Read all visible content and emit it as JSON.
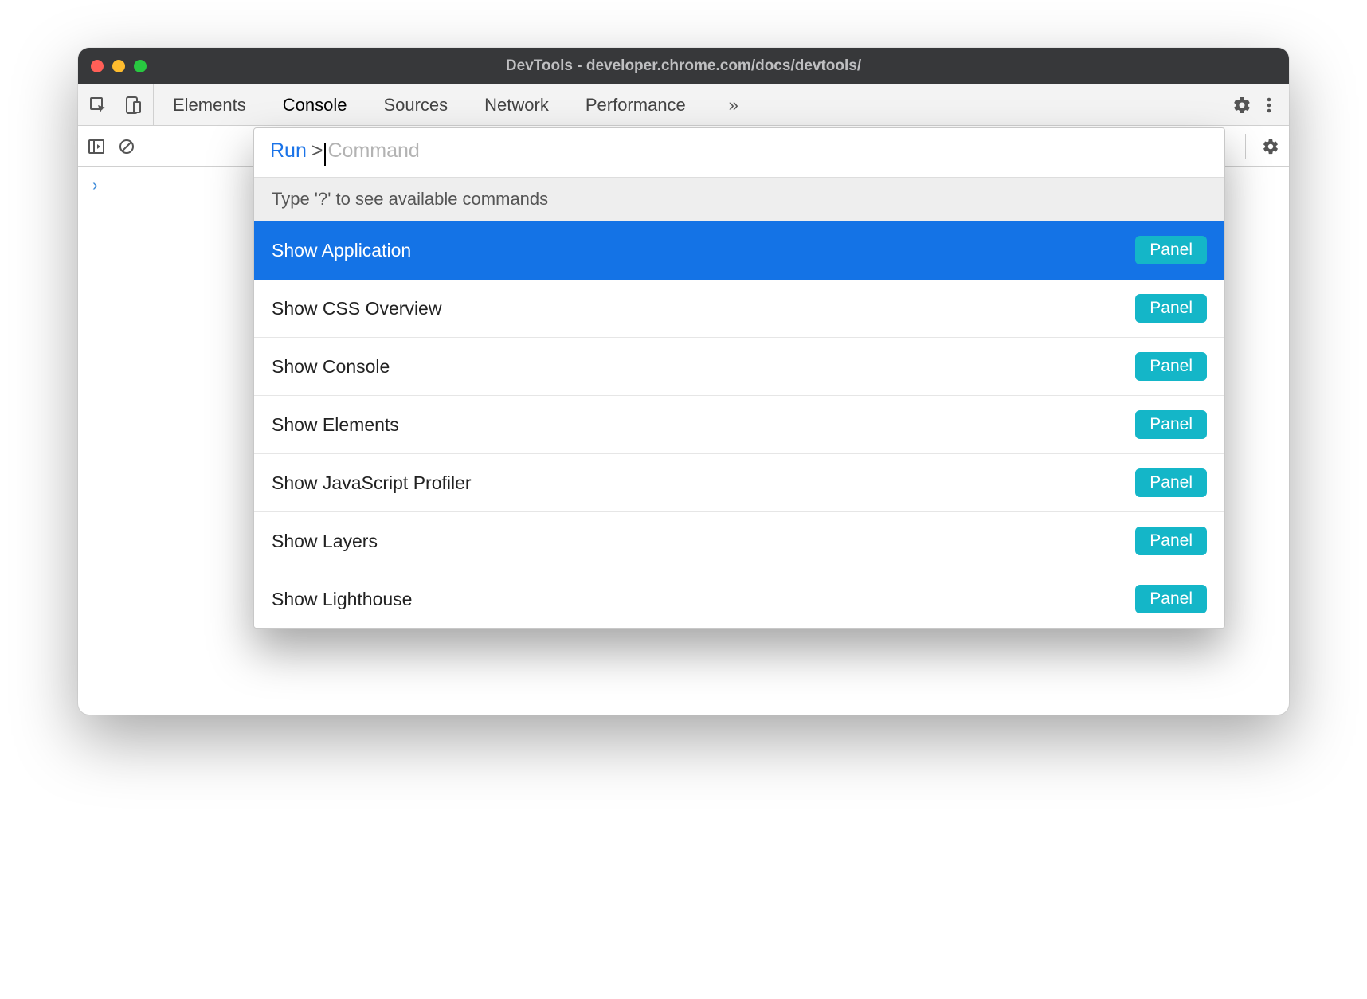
{
  "titlebar": {
    "title": "DevTools - developer.chrome.com/docs/devtools/"
  },
  "tabs": {
    "items": [
      {
        "label": "Elements",
        "active": false
      },
      {
        "label": "Console",
        "active": true
      },
      {
        "label": "Sources",
        "active": false
      },
      {
        "label": "Network",
        "active": false
      },
      {
        "label": "Performance",
        "active": false
      }
    ],
    "overflow_glyph": "»"
  },
  "palette": {
    "run_label": "Run",
    "gt": ">",
    "placeholder": "Command",
    "hint": "Type '?' to see available commands",
    "badge_label": "Panel",
    "items": [
      {
        "label": "Show Application",
        "badge": "Panel",
        "selected": true
      },
      {
        "label": "Show CSS Overview",
        "badge": "Panel",
        "selected": false
      },
      {
        "label": "Show Console",
        "badge": "Panel",
        "selected": false
      },
      {
        "label": "Show Elements",
        "badge": "Panel",
        "selected": false
      },
      {
        "label": "Show JavaScript Profiler",
        "badge": "Panel",
        "selected": false
      },
      {
        "label": "Show Layers",
        "badge": "Panel",
        "selected": false
      },
      {
        "label": "Show Lighthouse",
        "badge": "Panel",
        "selected": false
      }
    ]
  },
  "console": {
    "prompt_glyph": "›"
  },
  "colors": {
    "accent_blue": "#1473e6",
    "badge_teal": "#14b6c8"
  }
}
